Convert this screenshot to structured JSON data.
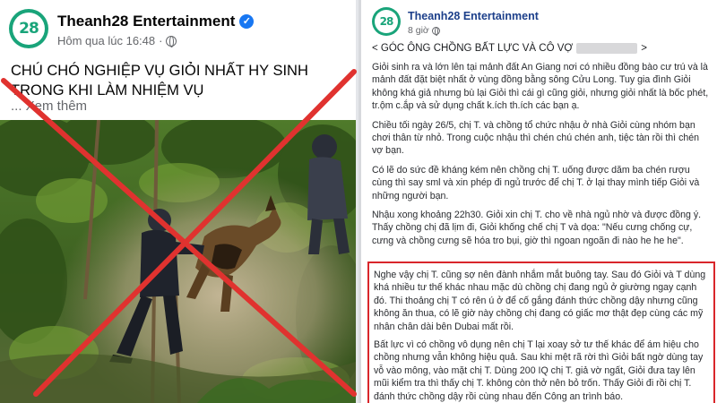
{
  "left_post": {
    "avatar_text": "28",
    "page_name": "Theanh28 Entertainment",
    "verified_mark": "✓",
    "timestamp": "Hôm qua lúc 16:48",
    "separator": "·",
    "title": "CHÚ CHÓ NGHIỆP VỤ GIỎI NHẤT HY SINH TRONG KHI LÀM NHIỆM VỤ",
    "see_more": "... Xem thêm",
    "photo_icon": "photo-police-dog"
  },
  "right_post": {
    "avatar_text": "28",
    "page_name": "Theanh28 Entertainment",
    "timestamp": "8 giờ",
    "heading_prefix": "< GÓC ÔNG CHỒNG BẤT LỰC VÀ CÔ VỢ",
    "heading_suffix": ">",
    "paragraphs": [
      "Giỏi sinh ra và lớn lên tại mảnh đất An Giang nơi có nhiều đồng bào cư trú và là mảnh đất đặt biệt nhất ở vùng đồng bằng sông Cửu Long. Tuy gia đình Giỏi không khá giả nhưng bù lại Giỏi thì cái gì cũng giỏi, nhưng giỏi nhất là bốc phét, tr.ộm c.ắp và sử dụng chất k.ích th.ích các bạn ạ.",
      "Chiều tối ngày 26/5, chị T. và chồng tổ chức nhậu ở nhà Giỏi cùng nhóm bạn chơi thân từ nhỏ. Trong cuộc nhậu thì chén chú chén anh, tiệc tàn rồi thì chén vợ bạn.",
      "Có lẽ do sức đề kháng kém nên chồng chị T. uống được dăm ba chén rượu cùng thì say sml và xin phép đi ngủ trước để chị T. ở lại thay mình tiếp Giỏi và những người bạn.",
      "Nhậu xong khoảng 22h30. Giỏi xin chị T. cho về nhà ngủ nhờ và được đồng ý. Thấy chồng chị đã lịm đi, Giỏi khống chế chị T và dọa: \"Nếu cưng chống cự, cưng và chồng cưng sẽ hóa tro bụi, giờ thì ngoan ngoãn đi nào he he he\"."
    ],
    "highlight_paragraphs": [
      "Nghe vậy chị T. cũng sợ nên đành nhắm mắt buông tay. Sau đó Giỏi và T dùng khá nhiều tư thế khác nhau mặc dù chồng chị đang ngủ ở giường ngay cạnh đó. Thi thoảng chị T có rên ú ở để cố gắng đánh thức chồng dậy nhưng cũng không ăn thua, có lẽ giờ này chồng chị đang có giấc mơ thật đẹp cùng các mỹ nhân chân dài bên Dubai mất rồi.",
      "Bất lực vì có chồng vô dụng nên chị T lại xoay sở tư thế khác để ám hiệu cho chồng nhưng vẫn không hiệu quả. Sau khi mệt rã rời thì Giỏi bất ngờ dùng tay vỗ vào mông, vào mặt chị T. Dùng 200 IQ chị T. giả vờ ngất, Giỏi đưa tay lên mũi kiểm tra thì thấy chị T. không còn thở nên bỏ trốn. Thấy Giỏi đi rồi chị T. đánh thức chồng dậy rồi cùng nhau đến Công an trình báo."
    ]
  },
  "overlay": {
    "cross_mark": "red-x-icon",
    "cross_color": "#e0322f"
  },
  "colors": {
    "brand": "#19a47a",
    "verified": "#1877f2",
    "highlight_border": "#d9262b"
  }
}
